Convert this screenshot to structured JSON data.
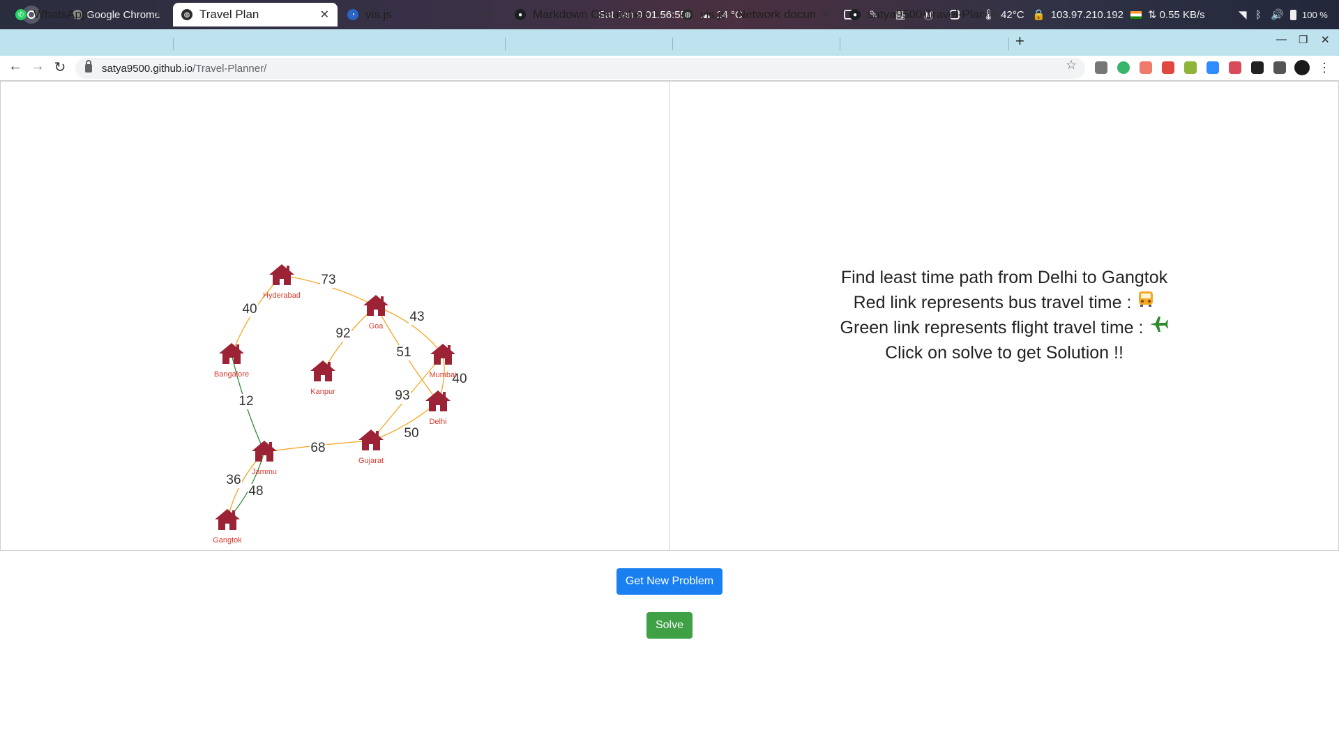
{
  "os": {
    "app_name": "Google Chrome",
    "datetime": "Sat Jan 9  01:56:55",
    "weather": "14 °C",
    "cpu_temp": "42°C",
    "ip": "103.97.210.192",
    "net_speed": "0.55 KB/s",
    "battery": "100 %"
  },
  "tabs": [
    {
      "title": "WhatsApp",
      "icon": "whatsapp-icon",
      "color": "#25d366",
      "active": false
    },
    {
      "title": "Travel Plan",
      "icon": "globe-icon",
      "color": "#2b2b2b",
      "active": true
    },
    {
      "title": "vis.js",
      "icon": "visjs-icon",
      "color": "#2a64c5",
      "active": false
    },
    {
      "title": "Markdown Cheatsheet",
      "icon": "github-icon",
      "color": "#1b1f23",
      "active": false
    },
    {
      "title": "vis.js - Network documentation",
      "icon": "globe-icon",
      "color": "#2b2b2b",
      "active": false
    },
    {
      "title": "satya9500/Travel-Planner",
      "icon": "github-icon",
      "color": "#1b1f23",
      "active": false
    }
  ],
  "address": {
    "host": "satya9500.github.io",
    "path": "/Travel-Planner/"
  },
  "graph": {
    "nodes": [
      {
        "id": "hyderabad",
        "label": "Hyderabad"
      },
      {
        "id": "goa",
        "label": "Goa"
      },
      {
        "id": "bangalore",
        "label": "Bangalore"
      },
      {
        "id": "kanpur",
        "label": "Kanpur"
      },
      {
        "id": "mumbai",
        "label": "Mumbai"
      },
      {
        "id": "delhi",
        "label": "Delhi"
      },
      {
        "id": "gujarat",
        "label": "Gujarat"
      },
      {
        "id": "jammu",
        "label": "Jammu"
      },
      {
        "id": "gangtok",
        "label": "Gangtok"
      }
    ],
    "edges": [
      {
        "from": "hyderabad",
        "to": "goa",
        "label": "73",
        "type": "bus"
      },
      {
        "from": "hyderabad",
        "to": "bangalore",
        "label": "40",
        "type": "bus"
      },
      {
        "from": "goa",
        "to": "kanpur",
        "label": "92",
        "type": "bus"
      },
      {
        "from": "goa",
        "to": "mumbai",
        "label": "43",
        "type": "bus"
      },
      {
        "from": "goa",
        "to": "delhi",
        "label": "51",
        "type": "bus"
      },
      {
        "from": "mumbai",
        "to": "delhi",
        "label": "40",
        "type": "bus"
      },
      {
        "from": "mumbai",
        "to": "gujarat",
        "label": "93",
        "type": "bus"
      },
      {
        "from": "delhi",
        "to": "gujarat",
        "label": "50",
        "type": "bus"
      },
      {
        "from": "bangalore",
        "to": "jammu",
        "label": "12",
        "type": "flight"
      },
      {
        "from": "jammu",
        "to": "gujarat",
        "label": "68",
        "type": "bus"
      },
      {
        "from": "jammu",
        "to": "gangtok",
        "label": "36",
        "type": "bus"
      },
      {
        "from": "jammu",
        "to": "gangtok",
        "label": "48",
        "type": "flight"
      }
    ],
    "colors": {
      "bus": "#f5a623",
      "flight": "#2e8b2e",
      "node": "#9b2335",
      "label": "#d63a2f"
    }
  },
  "info": {
    "line1": "Find least time path from Delhi to Gangtok",
    "line2": "Red link represents bus travel time :",
    "line2_icon": "bus-icon",
    "line3": "Green link represents flight travel time :",
    "line3_icon": "airplane-icon",
    "line4": "Click on solve to get Solution !!"
  },
  "buttons": {
    "new_problem": "Get New Problem",
    "solve": "Solve"
  }
}
